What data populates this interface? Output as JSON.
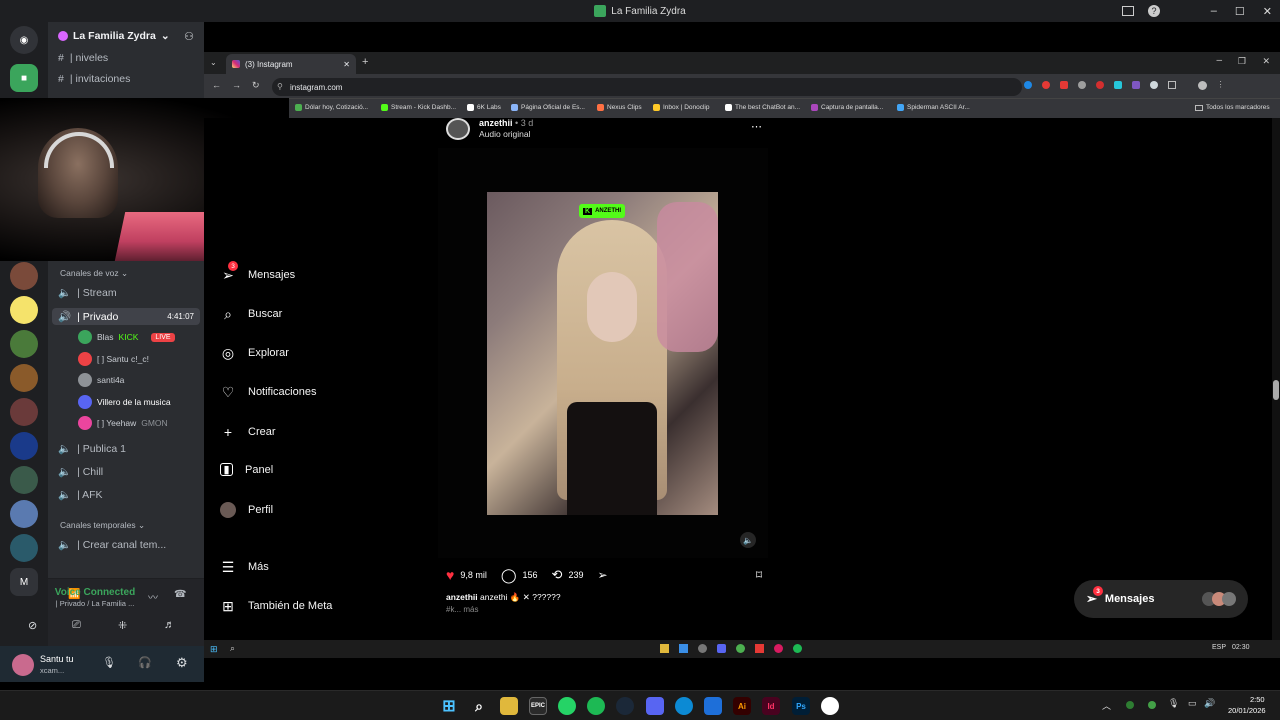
{
  "window": {
    "title": "La Familia Zydra"
  },
  "discord": {
    "server_name": "La Familia Zydra",
    "top_channels": [
      {
        "label": "| niveles"
      },
      {
        "label": "| invitaciones"
      }
    ],
    "voice_category": "Canales de voz",
    "voice_channels": [
      {
        "label": "| Stream"
      },
      {
        "label": "| Privado",
        "timer": "4:41:07"
      },
      {
        "label": "| Publica 1"
      },
      {
        "label": "| Chill"
      },
      {
        "label": "| AFK"
      }
    ],
    "voice_users": [
      {
        "name": "Blas",
        "extra": "KICK",
        "badge": "LIVE",
        "color": "#3ba55c"
      },
      {
        "name": "[ ] Santu c!_c!",
        "color": "#ed4245"
      },
      {
        "name": "santi4a",
        "color": "#8e9297"
      },
      {
        "name": "Villero de la musica",
        "color": "#5865f2"
      },
      {
        "name": "[ ] Yeehaw",
        "extra": "GMON",
        "color": "#eb459e"
      }
    ],
    "temp_category": "Canales temporales",
    "temp_channels": [
      {
        "label": "| Crear canal tem..."
      }
    ],
    "voice_status": {
      "title": "Voice Connected",
      "subtitle": "| Privado / La Familia ..."
    },
    "user": {
      "name": "Santu tu",
      "status": "xcam..."
    },
    "guild_letter": "M"
  },
  "browser": {
    "tab_title": "(3) Instagram",
    "url": "instagram.com",
    "bookmarks": [
      {
        "label": "Dólar hoy, Cotizació...",
        "color": "#4caf50"
      },
      {
        "label": "Stream - Kick Dashb...",
        "color": "#53fc18"
      },
      {
        "label": "6K Labs",
        "color": "#ffffff"
      },
      {
        "label": "Página Oficial de Es...",
        "color": "#8ab4f8"
      },
      {
        "label": "Nexus Clips",
        "color": "#ff7043"
      },
      {
        "label": "Inbox | Donoclip",
        "color": "#ffca28"
      },
      {
        "label": "The best ChatBot an...",
        "color": "#ffffff"
      },
      {
        "label": "Captura de pantalla...",
        "color": "#ab47bc"
      },
      {
        "label": "Spiderman ASCII Ar...",
        "color": "#42a5f5"
      }
    ],
    "all_bookmarks": "Todos los marcadores"
  },
  "instagram": {
    "nav": [
      {
        "label": "Mensajes",
        "icon": "send-icon",
        "badge": "3"
      },
      {
        "label": "Buscar",
        "icon": "search-icon"
      },
      {
        "label": "Explorar",
        "icon": "compass-icon"
      },
      {
        "label": "Notificaciones",
        "icon": "heart-icon"
      },
      {
        "label": "Crear",
        "icon": "plus-icon"
      },
      {
        "label": "Panel",
        "icon": "chart-icon"
      },
      {
        "label": "Perfil",
        "icon": "avatar-icon"
      },
      {
        "label": "Más",
        "icon": "menu-icon"
      },
      {
        "label": "También de Meta",
        "icon": "grid-icon"
      }
    ],
    "post": {
      "username": "anzethii",
      "time": "3 d",
      "audio": "Audio original",
      "likes": "9,8 mil",
      "comments": "156",
      "reposts": "239",
      "caption_user": "anzethii",
      "caption_text": "anzethi 🔥 ✕ ??????",
      "caption_more": "#k... más",
      "stream_badge": "ANZETHI"
    },
    "messages_pill": {
      "label": "Mensajes",
      "badge": "3"
    }
  },
  "tray": {
    "inner_lang": "ESP",
    "inner_time": "02:30",
    "time": "2:50",
    "date": "20/01/2026"
  },
  "colors": {
    "accent_red": "#ff3040",
    "discord_bg": "#2b2d31",
    "kick_green": "#53fc18"
  }
}
